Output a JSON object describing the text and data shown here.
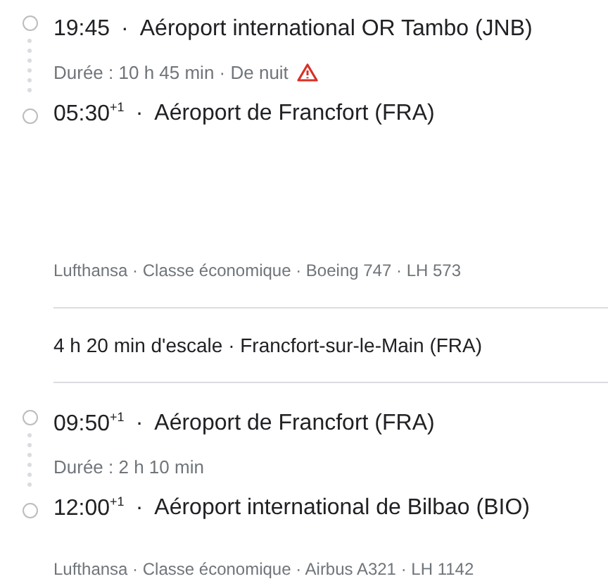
{
  "legs": [
    {
      "departure": {
        "time": "19:45",
        "airport": "·  Aéroport international OR Tambo (JNB)"
      },
      "duration": "Durée : 10 h 45 min · De nuit",
      "warning": true,
      "arrival": {
        "time": "05:30",
        "day_offset": "+1",
        "airport": "·  Aéroport de Francfort (FRA)"
      },
      "details": "Lufthansa · Classe économique · Boeing 747 · LH 573"
    },
    {
      "departure": {
        "time": "09:50",
        "day_offset": "+1",
        "airport": "·  Aéroport de Francfort (FRA)"
      },
      "duration": "Durée : 2 h 10 min",
      "warning": false,
      "arrival": {
        "time": "12:00",
        "day_offset": "+1",
        "airport": "·  Aéroport international de Bilbao (BIO)"
      },
      "details": "Lufthansa · Classe économique · Airbus A321 · LH 1142"
    }
  ],
  "layover": "4 h 20 min d'escale · Francfort-sur-le-Main (FRA)"
}
